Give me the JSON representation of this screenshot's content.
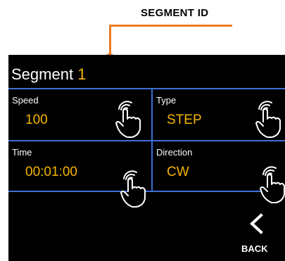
{
  "callout": {
    "label": "SEGMENT ID",
    "color": "#ef7c22"
  },
  "screen": {
    "title_prefix": "Segment",
    "title_number": "1",
    "accent_color": "#f5b400",
    "grid_color": "#3f6fd6",
    "fields": {
      "speed": {
        "label": "Speed",
        "value": "100"
      },
      "type": {
        "label": "Type",
        "value": "STEP"
      },
      "time": {
        "label": "Time",
        "value": "00:01:00"
      },
      "direction": {
        "label": "Direction",
        "value": "CW"
      }
    },
    "back": {
      "label": "BACK",
      "icon": "chevron-left-icon"
    },
    "touch_icon": "touch-hand-icon"
  }
}
